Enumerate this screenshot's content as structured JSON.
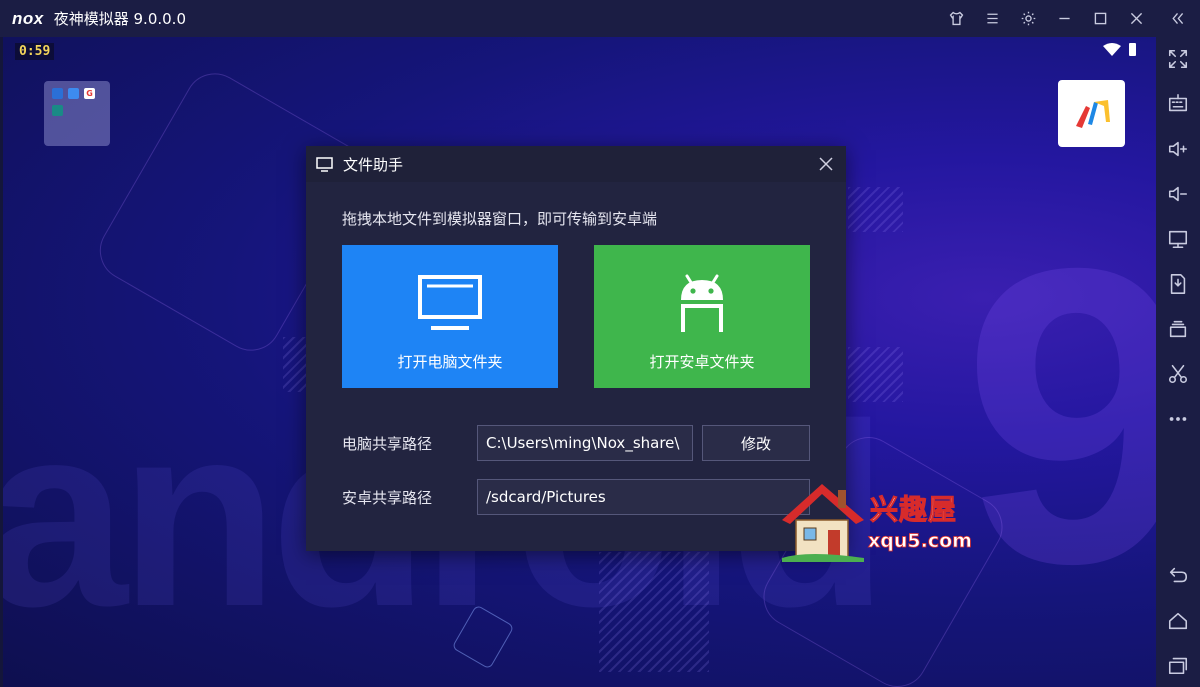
{
  "window": {
    "logo": "nox",
    "title": "夜神模拟器 9.0.0.0"
  },
  "status": {
    "clock": "0:59"
  },
  "dialog": {
    "title": "文件助手",
    "description": "拖拽本地文件到模拟器窗口，即可传输到安卓端",
    "open_pc_label": "打开电脑文件夹",
    "open_android_label": "打开安卓文件夹",
    "pc_path_label": "电脑共享路径",
    "pc_path_value": "C:\\Users\\ming\\Nox_share\\",
    "modify_label": "修改",
    "android_path_label": "安卓共享路径",
    "android_path_value": "/sdcard/Pictures"
  },
  "watermark": {
    "brand": "兴趣屋",
    "url": "xqu5.com"
  },
  "colors": {
    "pc_button": "#1e84f5",
    "android_button": "#3fb64c",
    "dialog_bg": "#222440",
    "clock": "#f3d55b"
  },
  "icons": {
    "titlebar": [
      "skin-icon",
      "menu-icon",
      "settings-icon",
      "minimize-icon",
      "maximize-icon",
      "close-icon",
      "collapse-sidebar-icon"
    ],
    "sidebar": [
      "fullscreen-icon",
      "keyboard-icon",
      "volume-up-icon",
      "volume-down-icon",
      "screen-icon",
      "install-apk-icon",
      "multi-instance-icon",
      "screenshot-icon",
      "more-icon",
      "back-icon",
      "home-icon",
      "recent-apps-icon"
    ]
  }
}
